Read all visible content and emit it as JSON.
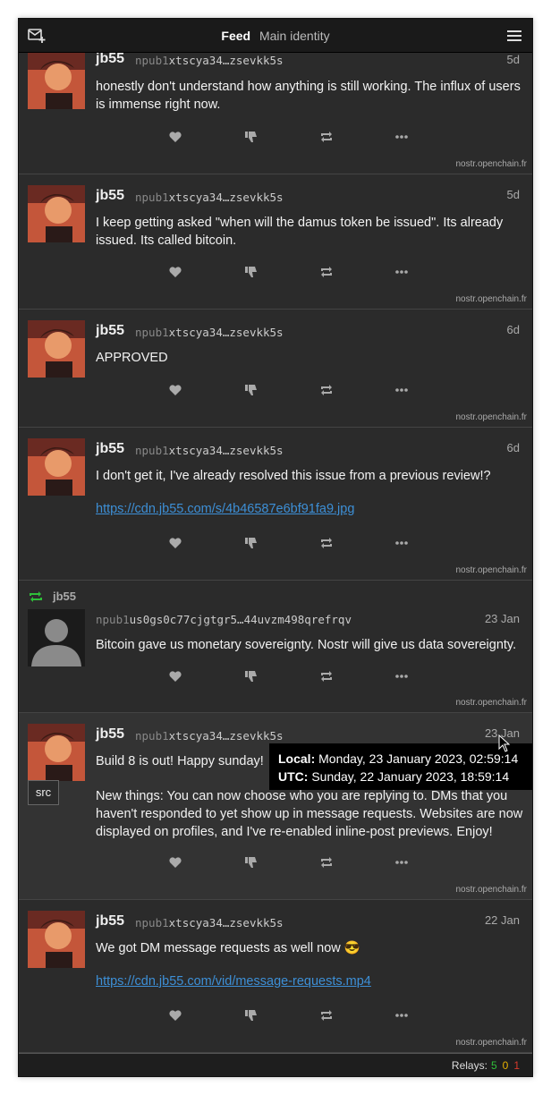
{
  "header": {
    "title": "Feed",
    "subtitle": "Main identity",
    "compose_icon": "compose-icon",
    "menu_icon": "hamburger-menu-icon"
  },
  "colors": {
    "accent_link": "#3d8fd6",
    "repost_green": "#2fbf3a",
    "background": "#2b2b2b"
  },
  "posts": [
    {
      "author": "jb55",
      "npub_prefix": "npub1",
      "npub_rest": "xtscya34…zsevkk5s",
      "time": "5d",
      "text": "honestly don't understand how anything is still working. The influx of users is immense right now.",
      "relay": "nostr.openchain.fr"
    },
    {
      "author": "jb55",
      "npub_prefix": "npub1",
      "npub_rest": "xtscya34…zsevkk5s",
      "time": "5d",
      "text": "I keep getting asked \"when will the damus token be issued\". Its already issued. Its called bitcoin.",
      "relay": "nostr.openchain.fr"
    },
    {
      "author": "jb55",
      "npub_prefix": "npub1",
      "npub_rest": "xtscya34…zsevkk5s",
      "time": "6d",
      "text": "APPROVED",
      "relay": "nostr.openchain.fr"
    },
    {
      "author": "jb55",
      "npub_prefix": "npub1",
      "npub_rest": "xtscya34…zsevkk5s",
      "time": "6d",
      "text": "I don't get it, I've already resolved this issue from a previous review!?",
      "link": "https://cdn.jb55.com/s/4b46587e6bf91fa9.jpg",
      "relay": "nostr.openchain.fr"
    },
    {
      "reposted_by": "jb55",
      "npub_prefix": "npub1",
      "npub_rest": "us0gs0c77cjgtgr5…44uvzm498qrefrqv",
      "time": "23 Jan",
      "text": "Bitcoin gave us monetary sovereignty. Nostr will give us data sovereignty.",
      "relay": "nostr.openchain.fr"
    },
    {
      "author": "jb55",
      "npub_prefix": "npub1",
      "npub_rest": "xtscya34…zsevkk5s",
      "time": "23 Jan",
      "text": "Build 8 is out! Happy sunday!",
      "text2": "New things: You can now choose who you are replying to. DMs that you haven't responded to yet show up in message requests. Websites are now displayed on profiles, and I've re-enabled inline-post previews. Enjoy!",
      "src_label": "src",
      "relay": "nostr.openchain.fr"
    },
    {
      "author": "jb55",
      "npub_prefix": "npub1",
      "npub_rest": "xtscya34…zsevkk5s",
      "time": "22 Jan",
      "text": "We got DM message requests as well now 😎",
      "link": "https://cdn.jb55.com/vid/message-requests.mp4",
      "relay": "nostr.openchain.fr"
    }
  ],
  "tooltip": {
    "local_label": "Local:",
    "local_value": "Monday, 23 January 2023, 02:59:14",
    "utc_label": "UTC:",
    "utc_value": "Sunday, 22 January 2023, 18:59:14"
  },
  "status": {
    "relays_label": "Relays:",
    "connected": "5",
    "connecting": "0",
    "failed": "1"
  }
}
